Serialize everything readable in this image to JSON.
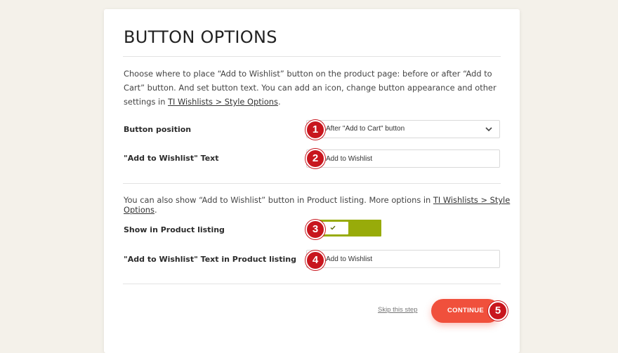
{
  "page": {
    "title": "BUTTON OPTIONS",
    "intro": {
      "text": "Choose where to place “Add to Wishlist” button on the product page: before or after “Add to Cart” button. And set button text. You can add an icon, change button appearance and other settings in ",
      "link": "TI Wishlists > Style Options",
      "suffix": "."
    }
  },
  "fields": {
    "button_position": {
      "label": "Button position",
      "value": "After \"Add to Cart\" button",
      "badge": "1"
    },
    "wishlist_text": {
      "label": "\"Add to Wishlist\" Text",
      "value": "Add to Wishlist",
      "badge": "2"
    },
    "show_in_listing": {
      "label": "Show in Product listing",
      "checked": true,
      "badge": "3"
    },
    "listing_text": {
      "label": "\"Add to Wishlist\" Text in Product listing",
      "value": "Add to Wishlist",
      "badge": "4"
    }
  },
  "listing_note": {
    "text": "You can also show “Add to Wishlist” button in Product listing. More options in ",
    "link": "TI Wishlists > Style Options",
    "suffix": "."
  },
  "footer": {
    "skip_label": "Skip this step",
    "continue_label": "CONTINUE",
    "badge": "5"
  },
  "colors": {
    "background": "#f4f1ea",
    "badge": "#c8161e",
    "toggle_on": "#98ab0a",
    "cta": "#f0503c"
  },
  "icons": {
    "dropdown": "chevron-down-icon",
    "toggle_check": "check-icon"
  }
}
